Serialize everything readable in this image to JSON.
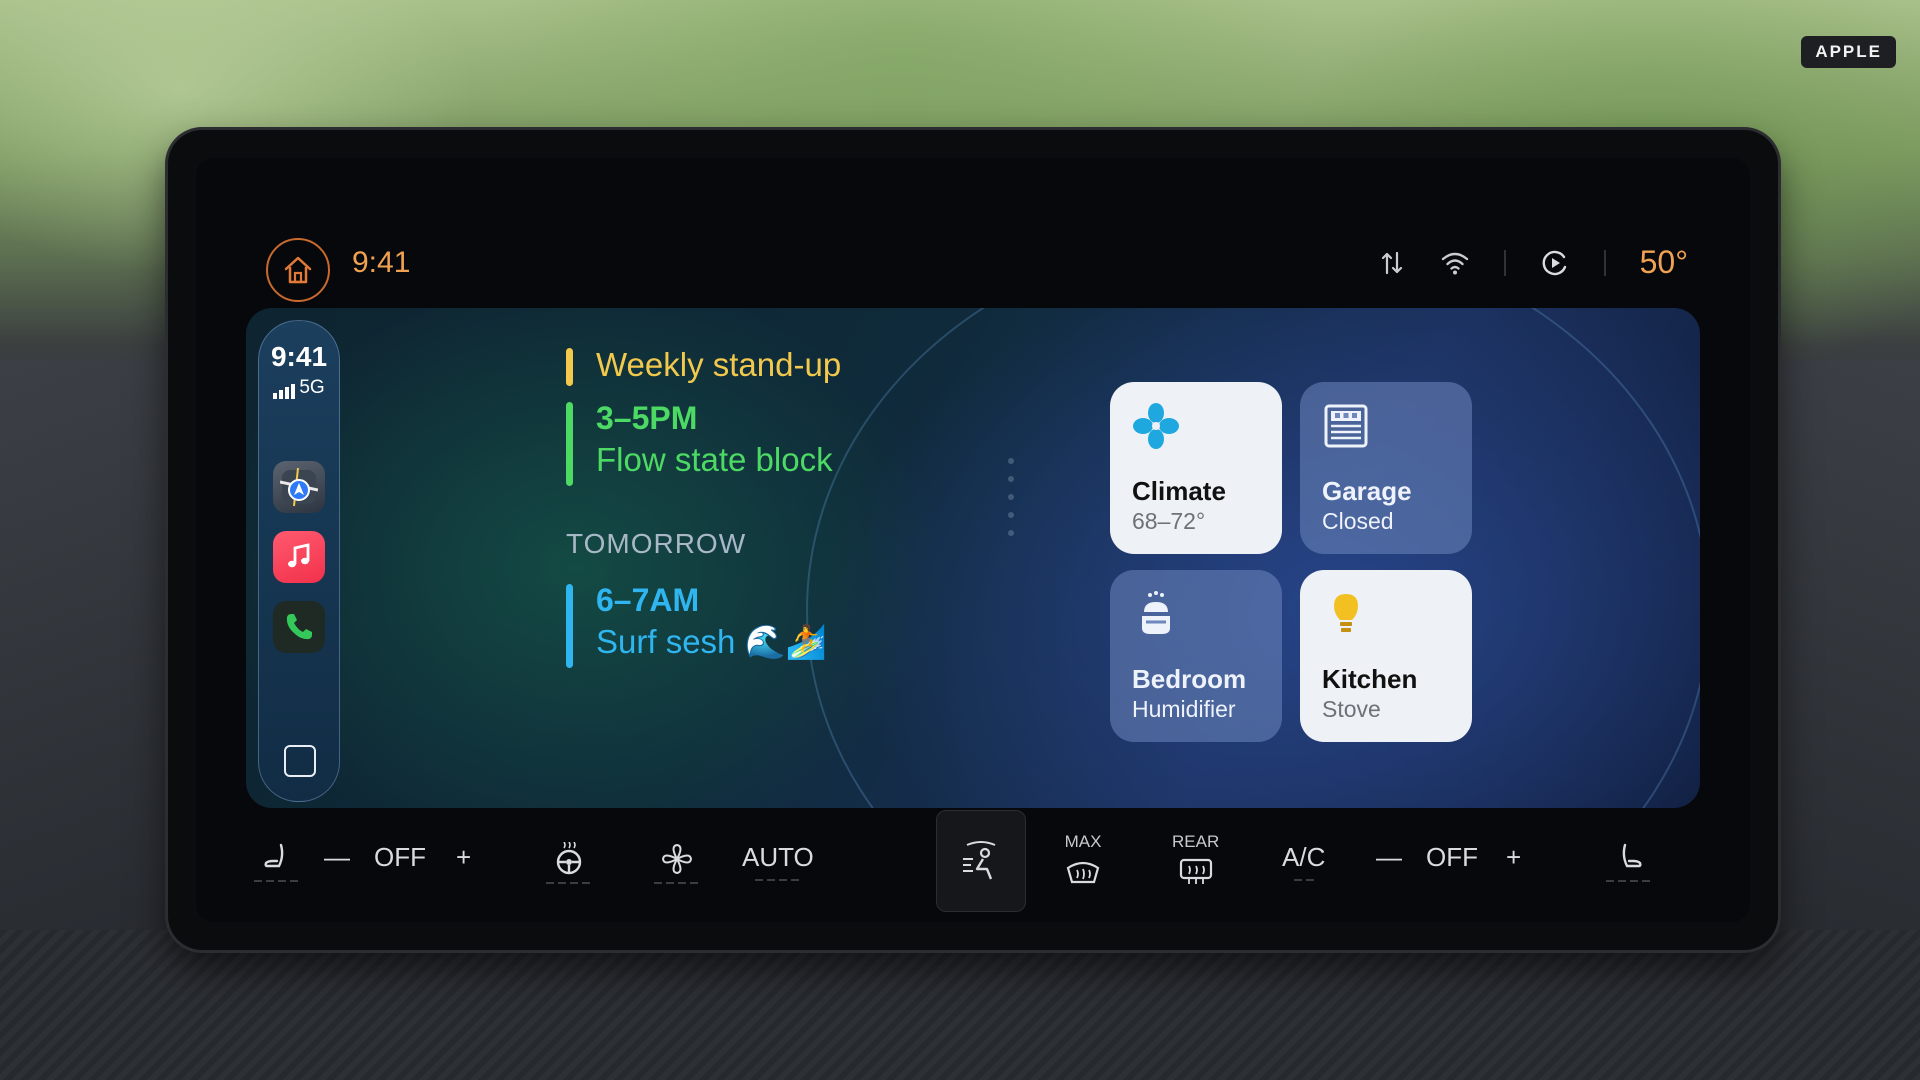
{
  "brand_badge": "APPLE",
  "status_bar": {
    "time": "9:41",
    "outside_temp": "50°"
  },
  "dock": {
    "time": "9:41",
    "network": "5G",
    "apps": [
      "maps-icon",
      "music-icon",
      "phone-icon"
    ]
  },
  "calendar": {
    "events_today": [
      {
        "title": "Weekly stand-up",
        "color": "#f2c94c"
      },
      {
        "time": "3–5PM",
        "title": "Flow state block",
        "color": "#4cd964"
      }
    ],
    "tomorrow_label": "TOMORROW",
    "events_tomorrow": [
      {
        "time": "6–7AM",
        "title": "Surf sesh 🌊🏄",
        "color": "#2fb5f0"
      }
    ]
  },
  "home_tiles": [
    {
      "name": "Climate",
      "state": "68–72°",
      "style": "light",
      "icon": "fan-icon"
    },
    {
      "name": "Garage",
      "state": "Closed",
      "style": "dark",
      "icon": "garage-door-icon"
    },
    {
      "name": "Bedroom",
      "state": "Humidifier",
      "style": "dark",
      "icon": "humidifier-icon"
    },
    {
      "name": "Kitchen",
      "state": "Stove",
      "style": "light",
      "icon": "stove-icon"
    }
  ],
  "climate_bar": {
    "left_temp": "OFF",
    "auto_label": "AUTO",
    "max_label": "MAX",
    "rear_label": "REAR",
    "ac_label": "A/C",
    "right_temp": "OFF",
    "minus": "—",
    "plus": "+"
  }
}
